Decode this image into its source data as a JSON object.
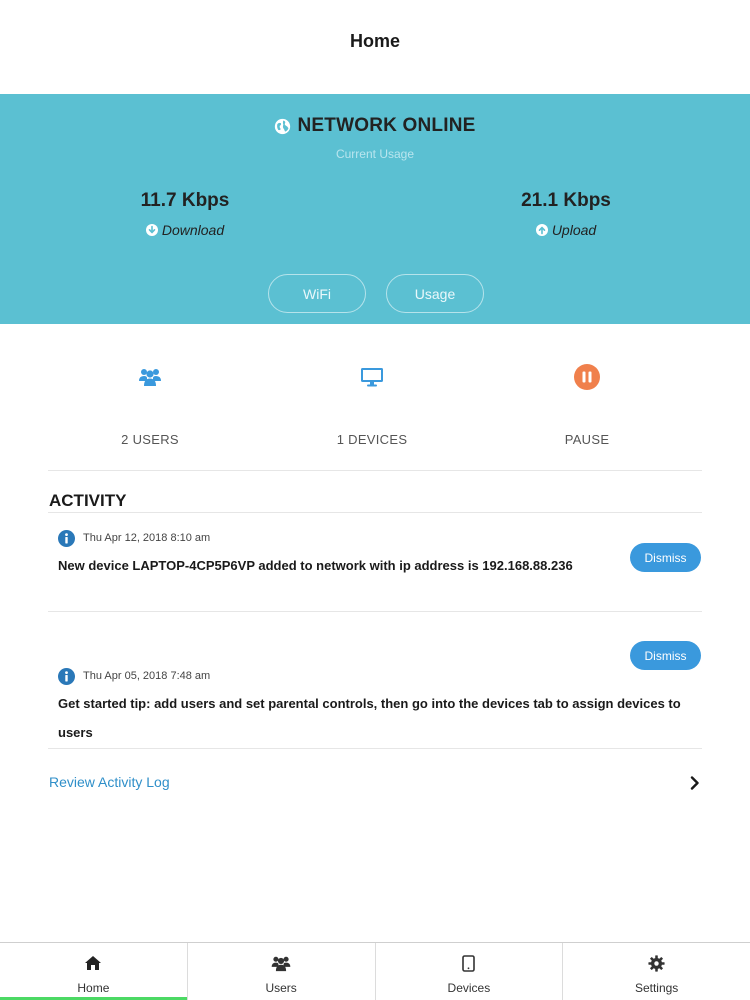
{
  "header": {
    "title": "Home"
  },
  "status": {
    "text": "NETWORK ONLINE",
    "caption": "Current Usage"
  },
  "download": {
    "value": "11.7 Kbps",
    "label": "Download"
  },
  "upload": {
    "value": "21.1 Kbps",
    "label": "Upload"
  },
  "pills": {
    "wifi": "WiFi",
    "usage": "Usage"
  },
  "quick": {
    "users": "2 USERS",
    "devices": "1 DEVICES",
    "pause": "PAUSE"
  },
  "activity": {
    "title": "ACTIVITY",
    "dismiss_label": "Dismiss",
    "items": [
      {
        "date": "Thu Apr 12, 2018 8:10 am",
        "message": "New device LAPTOP-4CP5P6VP added to network with ip address is 192.168.88.236"
      },
      {
        "date": "Thu Apr 05, 2018 7:48 am",
        "message": "Get started tip: add users and set parental controls, then go into the devices tab to assign devices to users"
      }
    ],
    "review_label": "Review Activity Log"
  },
  "tabs": [
    {
      "label": "Home",
      "icon": "home-icon",
      "active": true
    },
    {
      "label": "Users",
      "icon": "users-icon",
      "active": false
    },
    {
      "label": "Devices",
      "icon": "tablet-icon",
      "active": false
    },
    {
      "label": "Settings",
      "icon": "gear-icon",
      "active": false
    }
  ],
  "colors": {
    "hero": "#5bc0d2",
    "accent_blue": "#3a99dd",
    "pause_orange": "#f0804c",
    "tab_active": "#4cd964",
    "link": "#2f8fc9"
  }
}
